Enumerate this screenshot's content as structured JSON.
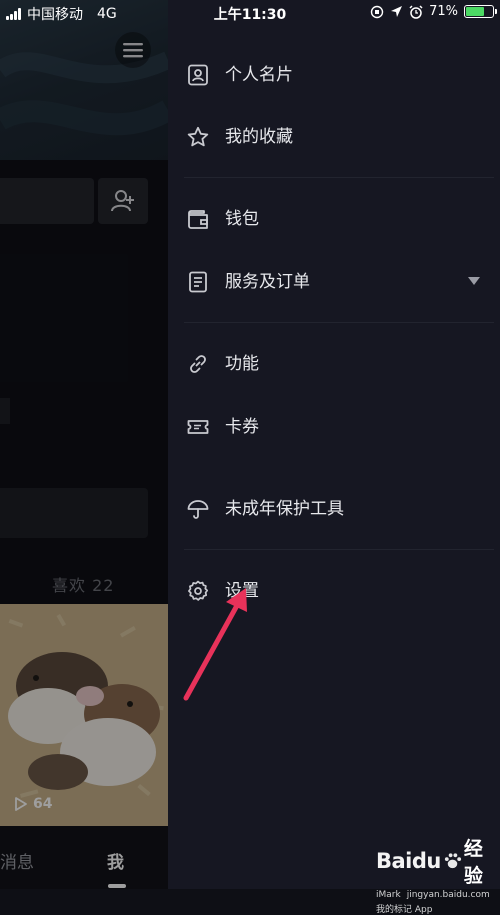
{
  "status_bar": {
    "carrier": "中国移动",
    "network": "4G",
    "time": "上午11:30",
    "battery_percent": "71%",
    "battery_level": 0.71
  },
  "background": {
    "likes_label": "喜欢 22",
    "video_play_count": "64",
    "tab_messages": "消息",
    "tab_me": "我"
  },
  "drawer": {
    "items": [
      {
        "label": "个人名片",
        "icon": "profile-card-icon"
      },
      {
        "label": "我的收藏",
        "icon": "star-icon"
      },
      {
        "label": "钱包",
        "icon": "wallet-icon"
      },
      {
        "label": "服务及订单",
        "icon": "order-list-icon"
      },
      {
        "label": "功能",
        "icon": "link-icon"
      },
      {
        "label": "卡券",
        "icon": "ticket-icon"
      },
      {
        "label": "未成年保护工具",
        "icon": "umbrella-icon"
      },
      {
        "label": "设置",
        "icon": "gear-icon"
      }
    ]
  },
  "watermark": {
    "brand": "Baidu",
    "suffix": "经验",
    "imark": "iMark",
    "url": "jingyan.baidu.com",
    "app": "我的标记 App"
  },
  "colors": {
    "drawer_bg": "#161722",
    "annotation_arrow": "#e8325a",
    "battery_fill": "#4cd964"
  }
}
